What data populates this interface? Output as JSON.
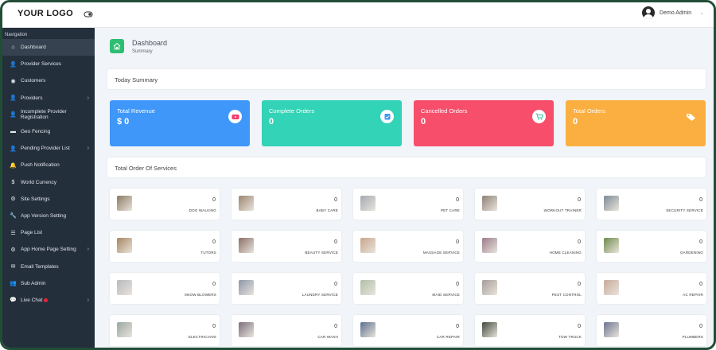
{
  "header": {
    "logo": "YOUR LOGO",
    "user_name": "Demo Admin"
  },
  "sidebar": {
    "title": "Navigation",
    "items": [
      {
        "label": "Dashboard",
        "icon": "home-icon"
      },
      {
        "label": "Provider Services",
        "icon": "user-plus-icon"
      },
      {
        "label": "Customers",
        "icon": "user-circle-icon"
      },
      {
        "label": "Providers",
        "icon": "user-icon"
      },
      {
        "label": "Incomplete Provider Registration",
        "icon": "user-plus-icon"
      },
      {
        "label": "Geo Fencing",
        "icon": "map-icon"
      },
      {
        "label": "Pending Provider List",
        "icon": "user-lock-icon"
      },
      {
        "label": "Push Notification",
        "icon": "bell-icon"
      },
      {
        "label": "World Currency",
        "icon": "dollar-icon"
      },
      {
        "label": "Site Settings",
        "icon": "gears-icon"
      },
      {
        "label": "App Version Setting",
        "icon": "wrench-icon"
      },
      {
        "label": "Page List",
        "icon": "list-icon"
      },
      {
        "label": "App Home Page Setting",
        "icon": "gears-icon"
      },
      {
        "label": "Email Templates",
        "icon": "envelope-icon"
      },
      {
        "label": "Sub Admin",
        "icon": "users-icon"
      },
      {
        "label": "Live Chat",
        "icon": "chat-icon"
      }
    ]
  },
  "page": {
    "title": "Dashboard",
    "subtitle": "Summary"
  },
  "today_summary": {
    "title": "Today Summary"
  },
  "stats": [
    {
      "label": "Total Revenue",
      "value": "$ 0",
      "color": "#3f97fa",
      "icon": "video-icon"
    },
    {
      "label": "Complete Orders",
      "value": "0",
      "color": "#32d3b6",
      "icon": "clipboard-check-icon"
    },
    {
      "label": "Cancelled Orders",
      "value": "0",
      "color": "#f74e6b",
      "icon": "cart-icon"
    },
    {
      "label": "Total Orders",
      "value": "0",
      "color": "#fbaf40",
      "icon": "tags-icon"
    }
  ],
  "services_section": {
    "title": "Total Order Of Services"
  },
  "services": [
    {
      "name": "DOG WALKING",
      "count": "0",
      "color": "#8b7a62"
    },
    {
      "name": "BABY CARE",
      "count": "0",
      "color": "#9c8572"
    },
    {
      "name": "PET CARE",
      "count": "0",
      "color": "#a3a9b2"
    },
    {
      "name": "WORKOUT TRAINER",
      "count": "0",
      "color": "#8f8176"
    },
    {
      "name": "SECURITY SERVICE",
      "count": "0",
      "color": "#7d8a92"
    },
    {
      "name": "TUTORS",
      "count": "0",
      "color": "#a7855f"
    },
    {
      "name": "BEAUTY SERVICE",
      "count": "0",
      "color": "#8a6f66"
    },
    {
      "name": "MASSAGE SERVICE",
      "count": "0",
      "color": "#c8a58a"
    },
    {
      "name": "HOME CLEANING",
      "count": "0",
      "color": "#9c7a8a"
    },
    {
      "name": "GARDENING",
      "count": "0",
      "color": "#6f8a4c"
    },
    {
      "name": "SNOW BLOWERS",
      "count": "0",
      "color": "#b8b9be"
    },
    {
      "name": "LAUNDRY SERVICE",
      "count": "0",
      "color": "#8c96a8"
    },
    {
      "name": "MAID SERVICE",
      "count": "0",
      "color": "#b0bfa9"
    },
    {
      "name": "PEST CONTROL",
      "count": "0",
      "color": "#a49c98"
    },
    {
      "name": "AC REPAIR",
      "count": "0",
      "color": "#c9a99a"
    },
    {
      "name": "ELECTRICIANS",
      "count": "0",
      "color": "#9aa7a0"
    },
    {
      "name": "CAR WASH",
      "count": "0",
      "color": "#7a6f7c"
    },
    {
      "name": "CAR REPAIR",
      "count": "0",
      "color": "#5c6f8e"
    },
    {
      "name": "TOW TRUCK",
      "count": "0",
      "color": "#3f4a3c"
    },
    {
      "name": "PLUMBERS",
      "count": "0",
      "color": "#6c7590"
    }
  ]
}
